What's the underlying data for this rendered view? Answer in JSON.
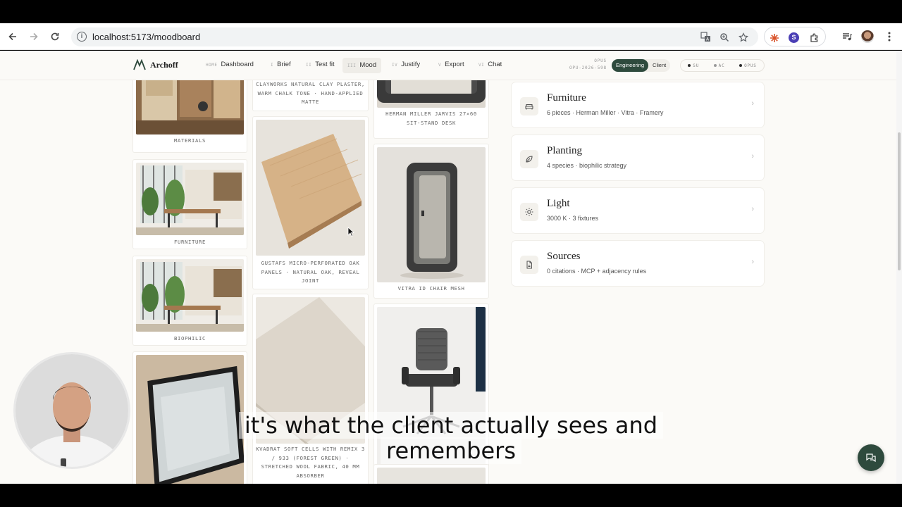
{
  "browser": {
    "url": "localhost:5173/moodboard",
    "icons": [
      "back-icon",
      "forward-icon",
      "reload-icon",
      "site-info-icon",
      "translate-icon",
      "zoom-icon",
      "bookmark-star-icon",
      "extension-sparkle-icon",
      "profile-s-icon",
      "extensions-puzzle-icon",
      "media-controls-icon",
      "account-avatar-icon",
      "menu-dots-icon"
    ],
    "profile_letter": "S"
  },
  "app": {
    "brand": "Archoff",
    "nav": [
      {
        "num": "HOME",
        "label": "Dashboard"
      },
      {
        "num": "I",
        "label": "Brief"
      },
      {
        "num": "II",
        "label": "Test fit"
      },
      {
        "num": "III",
        "label": "Mood"
      },
      {
        "num": "IV",
        "label": "Justify"
      },
      {
        "num": "V",
        "label": "Export"
      },
      {
        "num": "VI",
        "label": "Chat"
      }
    ],
    "project": {
      "label": "OPUS",
      "code": "OPU-2026-598"
    },
    "mode": {
      "engineering": "Engineering",
      "client": "Client"
    },
    "status": [
      {
        "label": "SU",
        "color": "#2b2b2b"
      },
      {
        "label": "AC",
        "color": "#9a9a9a"
      },
      {
        "label": "OPUS",
        "color": "#2b2b2b"
      }
    ]
  },
  "moodboard": {
    "col1": [
      {
        "caption": "MATERIALS"
      },
      {
        "caption": "FURNITURE"
      },
      {
        "caption": "BIOPHILIC"
      }
    ],
    "col2": [
      {
        "caption": "CLAYWORKS NATURAL CLAY PLASTER, WARM CHALK TONE · HAND-APPLIED MATTE"
      },
      {
        "caption": "GUSTAFS MICRO-PERFORATED OAK PANELS · NATURAL OAK, REVEAL JOINT"
      },
      {
        "caption": "KVADRAT SOFT CELLS WITH REMIX 3 / 933 (FOREST GREEN) · STRETCHED WOOL FABRIC, 40 MM ABSORBER"
      }
    ],
    "col3": [
      {
        "caption": "HERMAN MILLER JARVIS 27×60 SIT-STAND DESK"
      },
      {
        "caption": "VITRA ID CHAIR MESH"
      }
    ]
  },
  "sections": [
    {
      "title": "Furniture",
      "sub": "6 pieces · Herman Miller · Vitra · Framery",
      "icon": "sofa-icon"
    },
    {
      "title": "Planting",
      "sub": "4 species · biophilic strategy",
      "icon": "leaf-icon"
    },
    {
      "title": "Light",
      "sub": "3000 K · 3 fixtures",
      "icon": "sun-icon"
    },
    {
      "title": "Sources",
      "sub": "0 citations · MCP + adjacency rules",
      "icon": "document-icon"
    }
  ],
  "subtitles": [
    "it's what the client actually sees and",
    "remembers"
  ],
  "chat_fab_icon": "chat-bubble-icon"
}
